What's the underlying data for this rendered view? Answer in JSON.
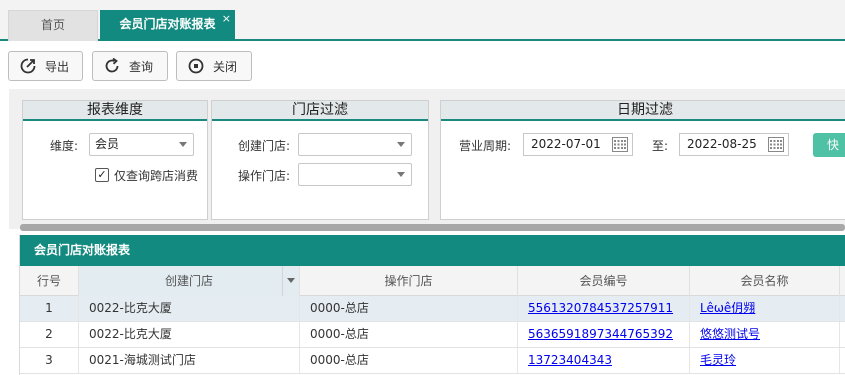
{
  "tabs": {
    "home": "首页",
    "active": "会员门店对账报表",
    "close": "×"
  },
  "toolbar": {
    "export": "导出",
    "query": "查询",
    "close": "关闭"
  },
  "filters": {
    "dimension": {
      "title": "报表维度",
      "label": "维度:",
      "value": "会员",
      "checkbox_label": "仅查询跨店消费",
      "checkbox_checked": true
    },
    "store": {
      "title": "门店过滤",
      "create_label": "创建门店:",
      "create_value": "",
      "operate_label": "操作门店:",
      "operate_value": ""
    },
    "date": {
      "title": "日期过滤",
      "period_label": "营业周期:",
      "start": "2022-07-01",
      "to_label": "至:",
      "end": "2022-08-25",
      "quick_button": "快捷"
    }
  },
  "grid": {
    "title": "会员门店对账报表",
    "columns": [
      "行号",
      "创建门店",
      "操作门店",
      "会员编号",
      "会员名称"
    ],
    "rows": [
      {
        "no": "1",
        "create_store": "0022-比克大厦",
        "operate_store": "0000-总店",
        "member_no": "5561320784537257911",
        "member_name": "Lêωê仴翙"
      },
      {
        "no": "2",
        "create_store": "0022-比克大厦",
        "operate_store": "0000-总店",
        "member_no": "5636591897344765392",
        "member_name": "悠悠测试号"
      },
      {
        "no": "3",
        "create_store": "0021-海城测试门店",
        "operate_store": "0000-总店",
        "member_no": "13723404343",
        "member_name": "毛灵玲"
      }
    ]
  },
  "colors": {
    "accent": "#138a80",
    "quick_button": "#4fc1a4",
    "link": "#0000ee"
  }
}
